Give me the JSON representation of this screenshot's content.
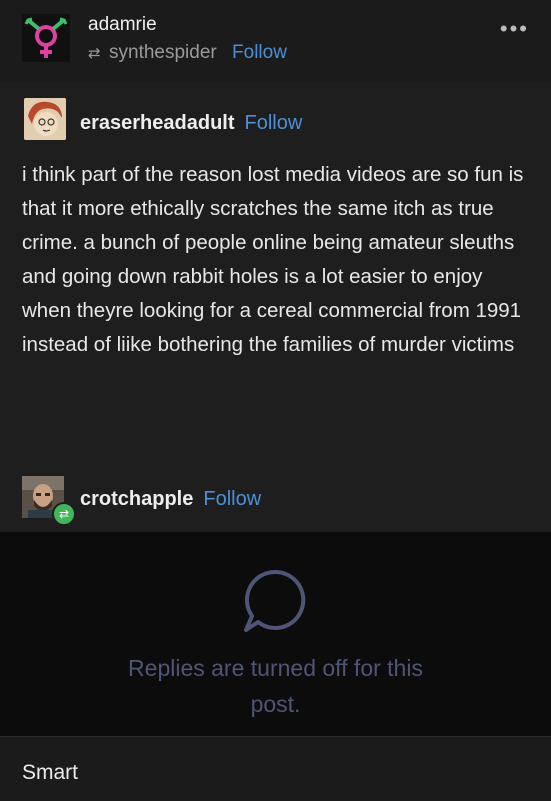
{
  "header": {
    "username": "adamrie",
    "reblogged_from": "synthespider",
    "follow_label": "Follow",
    "more_icon": "•••"
  },
  "post": {
    "author": "eraserheadadult",
    "follow_label": "Follow",
    "body": "i think part of the reason lost media videos are so fun is that it more ethically scratches the same itch as true crime. a bunch of people online being amateur sleuths and going down rabbit holes is a lot easier to enjoy when theyre looking for a cereal commercial from 1991 instead of liike bothering the families of murder victims"
  },
  "reply": {
    "author": "crotchapple",
    "follow_label": "Follow"
  },
  "replies": {
    "message": "Replies are turned off for this post."
  },
  "footer": {
    "text": "Smart"
  },
  "colors": {
    "accent": "#4d8fd6",
    "reblog_green": "#3fb65a",
    "muted_blue": "#4e5576"
  }
}
